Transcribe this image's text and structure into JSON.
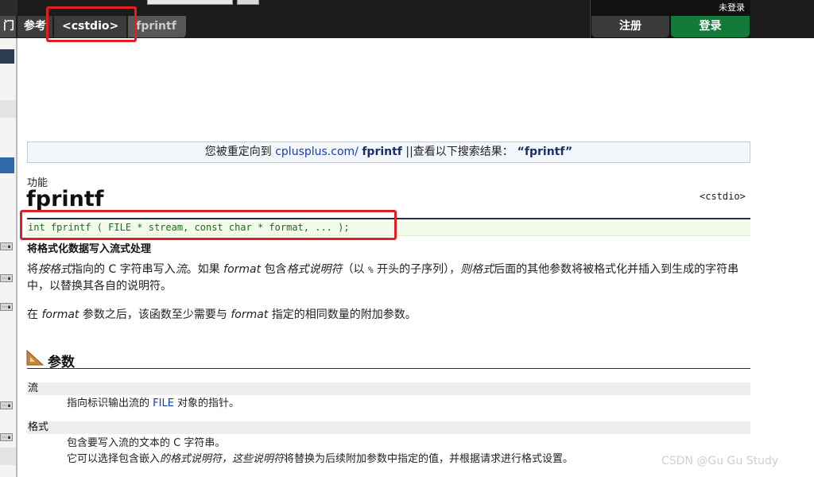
{
  "breadcrumb": {
    "first": "门",
    "reference": "参考",
    "header": "<cstdio>",
    "current": "fprintf"
  },
  "user": {
    "status": "未登录",
    "register": "注册",
    "login": "登录"
  },
  "sidebar": {
    "knob": "⋯∎"
  },
  "redirect": {
    "prefix": "您被重定向到 ",
    "site": "cplusplus.com/ ",
    "target": "fprintf",
    "mid": " ||查看以下搜索结果：",
    "query": " “fprintf”"
  },
  "article": {
    "label": "功能",
    "name": "fprintf",
    "header": "<cstdio>",
    "prototype": "int fprintf ( FILE * stream, const char * format, ... );",
    "summary": "将格式化数据写入流式处理",
    "desc1": {
      "p1": "将",
      "i1": "按格式",
      "p2": "指向的 C 字符串写入",
      "i2": "流",
      "p3": "。如果 ",
      "i3": "format",
      "p4": " 包含",
      "i4": "格式说明符",
      "p5": "（以 ",
      "code": "%",
      "p6": " 开头的子序列），",
      "i5": "则格式",
      "p7": "后面的其他参数将被格式化并插入到生成的字符串中，以替换其各自的说明符。"
    },
    "desc2": {
      "p1": "在 ",
      "i1": "format",
      "p2": " 参数之后，该函数至少需要与 ",
      "i2": "format",
      "p3": " 指定的相同数量的附加参数。"
    }
  },
  "params": {
    "title": "参数",
    "items": [
      {
        "name": "流",
        "desc_a": "指向标识输出流的 ",
        "desc_kw": "FILE",
        "desc_b": " 对象的指针。"
      },
      {
        "name": "格式",
        "line1": "包含要写入流的文本的 C 字符串。",
        "line2_a": "它可以选择包含嵌入",
        "line2_i1": "的格式说明符，这些说明符",
        "line2_b": "将替换为后续附加参数中指定的值，并根据请求进行格式设置。"
      }
    ]
  },
  "watermark": "CSDN @Gu Gu Study",
  "colors": {
    "topbar": "#1b1b1b",
    "login": "#147a3a",
    "highlight": "#e02020",
    "code_green": "#1e6b1e",
    "link_blue": "#1a3ea8"
  }
}
